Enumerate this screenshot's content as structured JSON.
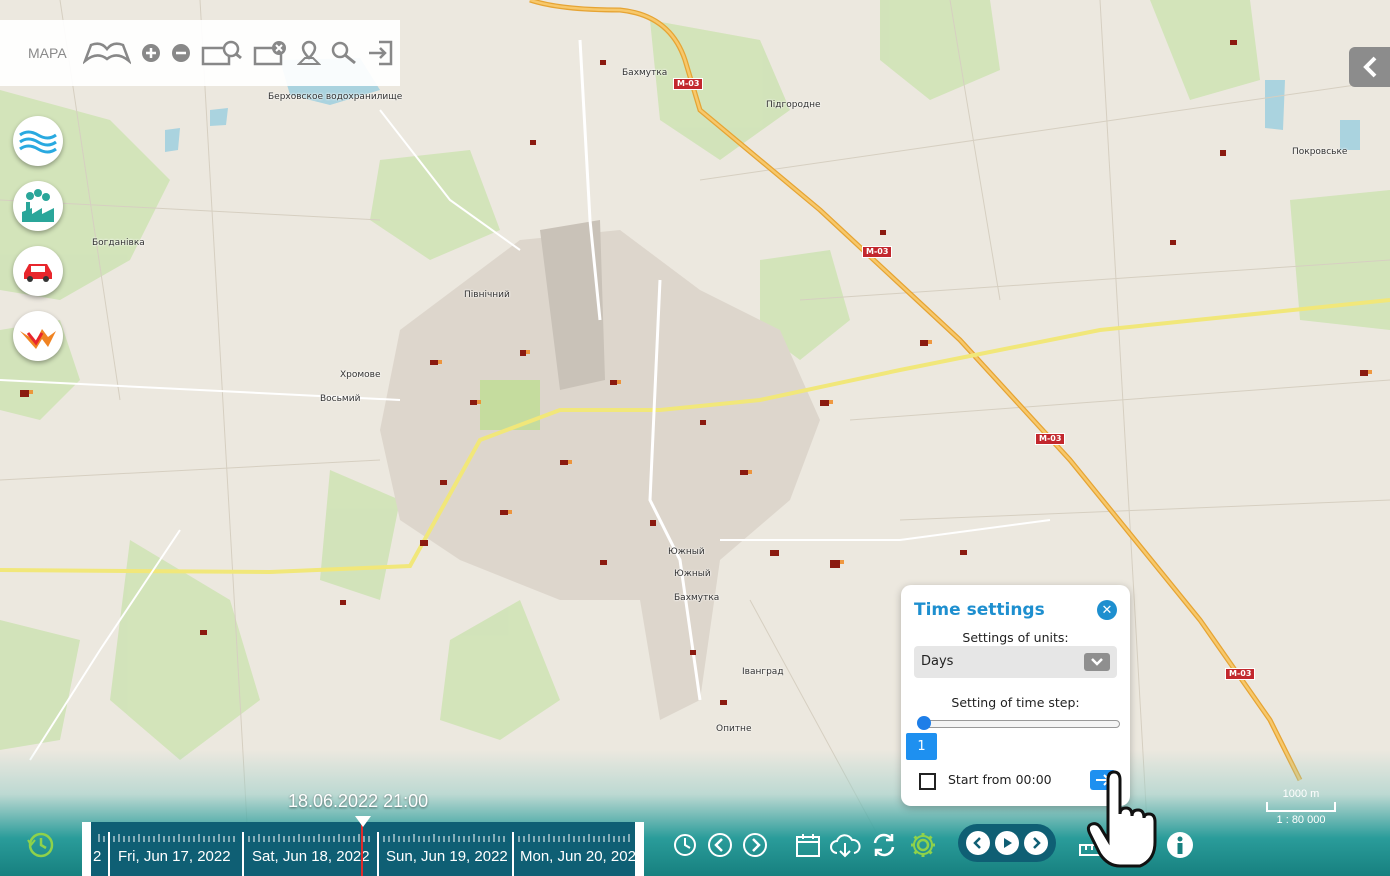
{
  "toolbar": {
    "map_label": "МАРА",
    "icons": [
      "open-book-icon",
      "zoom-in-icon",
      "zoom-out-icon",
      "magnify-area-icon",
      "clear-selection-icon",
      "place-marker-icon",
      "search-key-icon",
      "exit-icon"
    ]
  },
  "layers": [
    "water-layer-icon",
    "industry-emissions-layer-icon",
    "traffic-car-layer-icon",
    "fire-layer-icon"
  ],
  "map_labels": {
    "reservoir": "Берховское водохранилище",
    "bakhmutka_n": "Бахмутка",
    "pidgorodne": "Підгородне",
    "pokrovske": "Покровське",
    "bohdanivka": "Богданівка",
    "pivnichnyi": "Північний",
    "khromove": "Хромове",
    "vosmyi": "Восьмий",
    "yuzhnyi1": "Южный",
    "yuzhnyi2": "Южный",
    "bakhmutka_s": "Бахмутка",
    "ivangrad": "Іванград",
    "opytne": "Опитне",
    "m03_1": "М-03",
    "m03_2": "М-03",
    "m03_3": "М-03",
    "m03_4": "М-03"
  },
  "timeline": {
    "current": "18.06.2022 21:00",
    "days": [
      "2",
      "Fri, Jun 17, 2022",
      "Sat, Jun 18, 2022",
      "Sun, Jun 19, 2022",
      "Mon, Jun 20, 2022"
    ]
  },
  "scale": {
    "distance": "1000 m",
    "ratio": "1 : 80 000"
  },
  "time_settings": {
    "title": "Time settings",
    "units_label": "Settings of units:",
    "units_value": "Days",
    "step_label": "Setting of time step:",
    "step_value": "1",
    "start_label": "Start from 00:00"
  }
}
